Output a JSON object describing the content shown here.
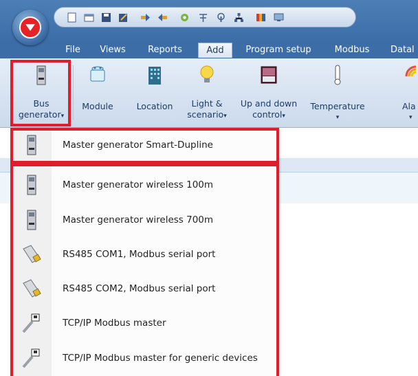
{
  "tabs": [
    {
      "label": "File",
      "active": false
    },
    {
      "label": "Views",
      "active": false
    },
    {
      "label": "Reports",
      "active": false
    },
    {
      "label": "Add",
      "active": true
    },
    {
      "label": "Program setup",
      "active": false
    },
    {
      "label": "Modbus",
      "active": false
    },
    {
      "label": "Datal",
      "active": false
    }
  ],
  "ribbon": {
    "bus_generator": {
      "line1": "Bus",
      "line2": "generator",
      "arrow": "▾",
      "icon": "bus-generator-icon"
    },
    "module": {
      "label": "Module",
      "icon": "module-icon"
    },
    "location": {
      "label": "Location",
      "icon": "building-icon"
    },
    "light": {
      "line1": "Light &",
      "line2": "scenario",
      "arrow": "▾",
      "icon": "light-bulb-icon"
    },
    "updown": {
      "line1": "Up and down",
      "line2": "control",
      "arrow": "▾",
      "icon": "window-blind-icon"
    },
    "temperature": {
      "label": "Temperature",
      "arrow": "▾",
      "icon": "thermometer-icon"
    },
    "alarm": {
      "label": "Ala",
      "arrow": "▾",
      "icon": "alarm-icon"
    }
  },
  "menu": {
    "items": [
      {
        "label": "Master generator Smart-Dupline",
        "icon": "master-generator-icon"
      },
      {
        "label": "Master generator wireless 100m",
        "icon": "master-generator-icon"
      },
      {
        "label": "Master generator wireless 700m",
        "icon": "master-generator-icon"
      },
      {
        "label": "RS485 COM1, Modbus serial port",
        "icon": "serial-port-icon"
      },
      {
        "label": "RS485 COM2, Modbus serial port",
        "icon": "serial-port-icon"
      },
      {
        "label": "TCP/IP Modbus master",
        "icon": "ethernet-plug-icon"
      },
      {
        "label": "TCP/IP Modbus master for generic devices",
        "icon": "ethernet-plug-icon"
      }
    ]
  },
  "colors": {
    "highlight_border": "#e21d2b",
    "ribbon_background": "#cbdaec",
    "tab_bar": "#3c6da7"
  }
}
